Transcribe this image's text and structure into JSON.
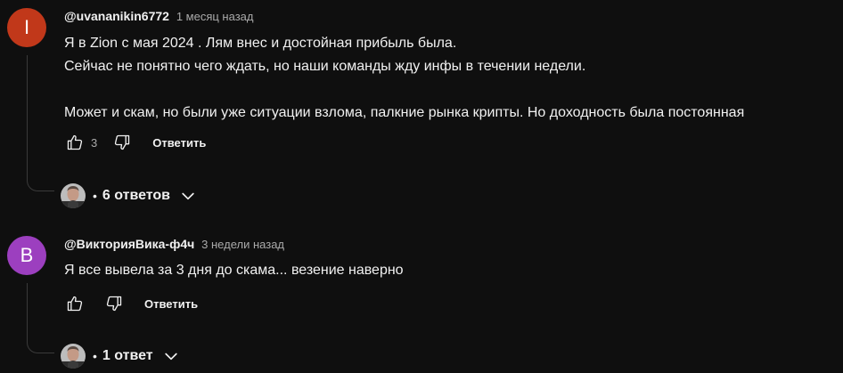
{
  "comments": [
    {
      "avatar_letter": "I",
      "avatar_color": "#c1381a",
      "author": "@uvananikin6772",
      "time": "1 месяц назад",
      "lines": [
        "Я в Zion с мая 2024 . Лям внес и достойная прибыль была.",
        "Сейчас не понятно чего ждать, но наши команды жду инфы в течении недели.",
        "",
        "Может и скам, но были уже ситуации взлома, палкние рынка крипты. Но доходность была постоянная"
      ],
      "likes": "3",
      "reply_label": "Ответить",
      "replies_label": "6 ответов"
    },
    {
      "avatar_letter": "B",
      "avatar_color": "#9c3fbf",
      "author": "@ВикторияВика-ф4ч",
      "time": "3 недели назад",
      "lines": [
        "Я все вывела за 3 дня до скама... везение наверно"
      ],
      "likes": "",
      "reply_label": "Ответить",
      "replies_label": "1 ответ"
    }
  ],
  "icons": {
    "like": "thumb-up-icon",
    "dislike": "thumb-down-icon",
    "expand": "chevron-down-icon"
  }
}
